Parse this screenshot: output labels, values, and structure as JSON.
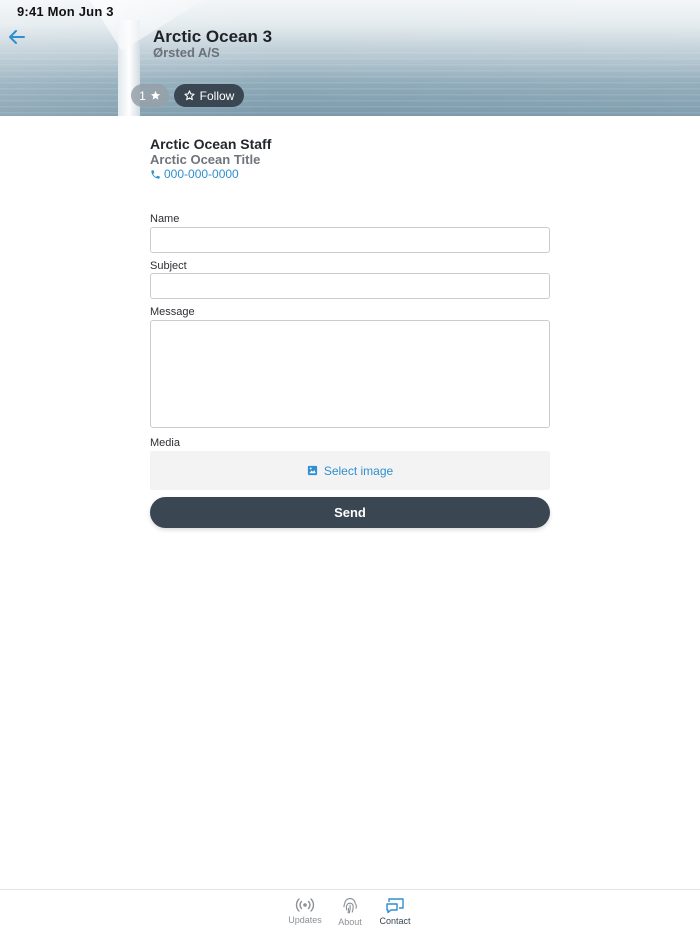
{
  "status_bar": {
    "time": "9:41 Mon Jun 3"
  },
  "header": {
    "title": "Arctic Ocean 3",
    "subtitle": "Ørsted A/S",
    "rating_count": "1",
    "follow_label": "Follow",
    "back_icon": "arrow-left-icon"
  },
  "contact": {
    "name": "Arctic Ocean Staff",
    "title": "Arctic Ocean Title",
    "phone": "000-000-0000",
    "phone_icon": "phone-icon"
  },
  "form": {
    "name_label": "Name",
    "name_value": "",
    "subject_label": "Subject",
    "subject_value": "",
    "message_label": "Message",
    "message_value": "",
    "media_label": "Media",
    "select_image_label": "Select image",
    "send_label": "Send"
  },
  "tabs": [
    {
      "label": "Updates",
      "icon": "broadcast-icon",
      "active": false
    },
    {
      "label": "About",
      "icon": "fingerprint-icon",
      "active": false
    },
    {
      "label": "Contact",
      "icon": "chat-screen-icon",
      "active": true
    }
  ],
  "colors": {
    "accent": "#2f8fcf",
    "primary_dark": "#3a4651",
    "text": "#2c2f33",
    "muted": "#8c9196"
  }
}
